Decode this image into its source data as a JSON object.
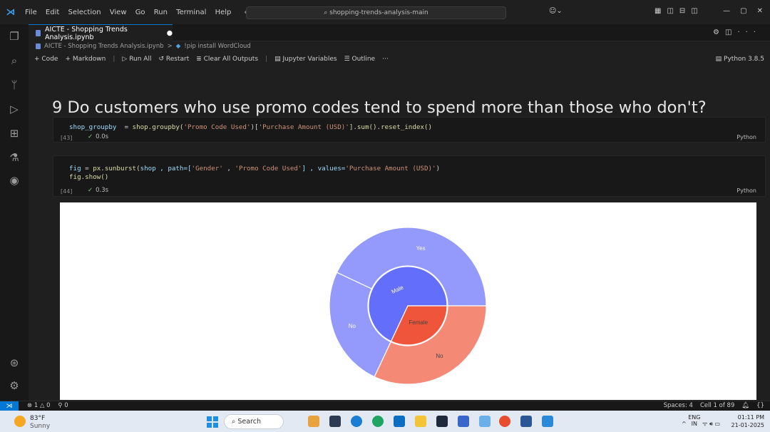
{
  "titlebar": {
    "menu": [
      "File",
      "Edit",
      "Selection",
      "View",
      "Go",
      "Run",
      "Terminal",
      "Help"
    ],
    "search": "shopping-trends-analysis-main"
  },
  "tab": {
    "title": "AICTE - Shopping Trends Analysis.ipynb"
  },
  "breadcrumb": {
    "file": "AICTE - Shopping Trends Analysis.ipynb",
    "sep": ">",
    "cell": "!pip install WordCloud"
  },
  "toolbar": {
    "code": "+ Code",
    "markdown": "+ Markdown",
    "run_all": "Run All",
    "restart": "Restart",
    "clear": "Clear All Outputs",
    "variables": "Jupyter Variables",
    "outline": "Outline",
    "more": "···",
    "kernel": "Python 3.8.5"
  },
  "notebook": {
    "heading": "9 Do customers who use promo codes tend to spend more than those who don't?",
    "cell1": {
      "exec": "[43]",
      "time": "0.0s",
      "lang": "Python",
      "line1_var": "shop_groupby",
      "line1_eq": "  = ",
      "line1_fn": "shop.groupby(",
      "line1_s1": "'Promo Code Used'",
      "line1_b1": ")[",
      "line1_s2": "'Purchase Amount (USD)'",
      "line1_end": "].sum().reset_index()"
    },
    "cell2": {
      "exec": "[44]",
      "time": "0.3s",
      "lang": "Python",
      "line1_var": "fig",
      "line1_eq": " = ",
      "line1_fn": "px.sunburst(",
      "line1_args": "shop , path=[",
      "line1_s1": "'Gender'",
      "line1_comma": " , ",
      "line1_s2": "'Promo Code Used'",
      "line1_mid": "] , values=",
      "line1_s3": "'Purchase Amount (USD)'",
      "line1_end": ")",
      "line2": "fig.show()"
    },
    "output_dots": "···"
  },
  "chart_data": {
    "type": "sunburst",
    "inner": [
      {
        "label": "Male",
        "value": 0.68,
        "color": "#636efa"
      },
      {
        "label": "Female",
        "value": 0.32,
        "color": "#ef553b"
      }
    ],
    "outer": [
      {
        "label": "Yes",
        "parent": "Male",
        "value": 0.43,
        "color": "#949afb"
      },
      {
        "label": "No",
        "parent": "Male",
        "value": 0.25,
        "color": "#949afb"
      },
      {
        "label": "No",
        "parent": "Female",
        "value": 0.32,
        "color": "#f48a76"
      }
    ]
  },
  "statusbar": {
    "errors": "⊗ 1 △ 0",
    "ports": "⚲ 0",
    "spaces": "Spaces: 4",
    "cell": "Cell 1 of 89"
  },
  "taskbar": {
    "temp": "83°F",
    "weather": "Sunny",
    "search": "Search",
    "lang1": "ENG",
    "lang2": "IN",
    "time": "01:11 PM",
    "date": "21-01-2025"
  }
}
